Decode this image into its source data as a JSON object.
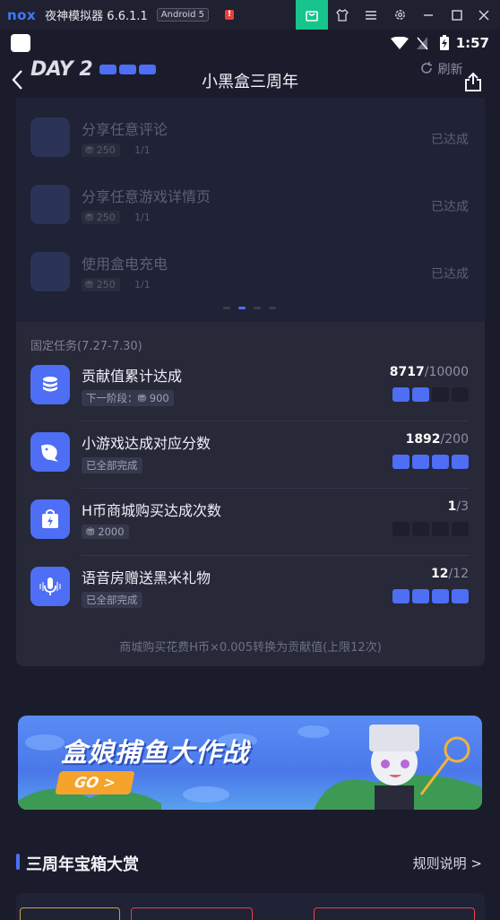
{
  "emulator": {
    "logo": "nox",
    "title": "夜神模拟器 6.6.1.1",
    "android_badge": "Android 5",
    "icons": [
      "bag-icon",
      "shirt-icon",
      "menu-icon",
      "settings-icon",
      "minimize-icon",
      "maximize-icon",
      "close-icon"
    ]
  },
  "status_bar": {
    "time": "1:57"
  },
  "header": {
    "day_label": "DAY 2",
    "title": "小黑盒三周年",
    "refresh_label": "刷新"
  },
  "completed_tasks": [
    {
      "title": "分享任意评论",
      "coins": "250",
      "progress": "1/1",
      "status": "已达成"
    },
    {
      "title": "分享任意游戏详情页",
      "coins": "250",
      "progress": "1/1",
      "status": "已达成"
    },
    {
      "title": "使用盒电充电",
      "coins": "250",
      "progress": "1/1",
      "status": "已达成"
    }
  ],
  "fixed_tasks": {
    "header": "固定任务(7.27-7.30)",
    "items": [
      {
        "title": "贡献值累计达成",
        "sub": "下一阶段：",
        "sub_coins": "900",
        "current": "8717",
        "total": "/10000",
        "filled": 2,
        "icon": "database-icon"
      },
      {
        "title": "小游戏达成对应分数",
        "sub": "已全部完成",
        "sub_coins": "",
        "current": "1892",
        "total": "/200",
        "filled": 4,
        "icon": "fish-icon"
      },
      {
        "title": "H币商城购买达成次数",
        "sub": "",
        "sub_coins": "2000",
        "current": "1",
        "total": "/3",
        "filled": 0,
        "icon": "shop-bag-icon"
      },
      {
        "title": "语音房赠送黑米礼物",
        "sub": "已全部完成",
        "sub_coins": "",
        "current": "12",
        "total": "/12",
        "filled": 4,
        "icon": "microphone-icon"
      }
    ],
    "note": "商城购买花费H币×0.005转换为贡献值(上限12次)"
  },
  "banner": {
    "title": "盒娘捕鱼大作战",
    "go_label": "GO >"
  },
  "section": {
    "title": "三周年宝箱大赏",
    "link": "规则说明 >"
  },
  "colors": {
    "accent": "#4d6ef5",
    "background": "#1b1c2b",
    "card": "#272838",
    "go": "#f6a32b"
  }
}
